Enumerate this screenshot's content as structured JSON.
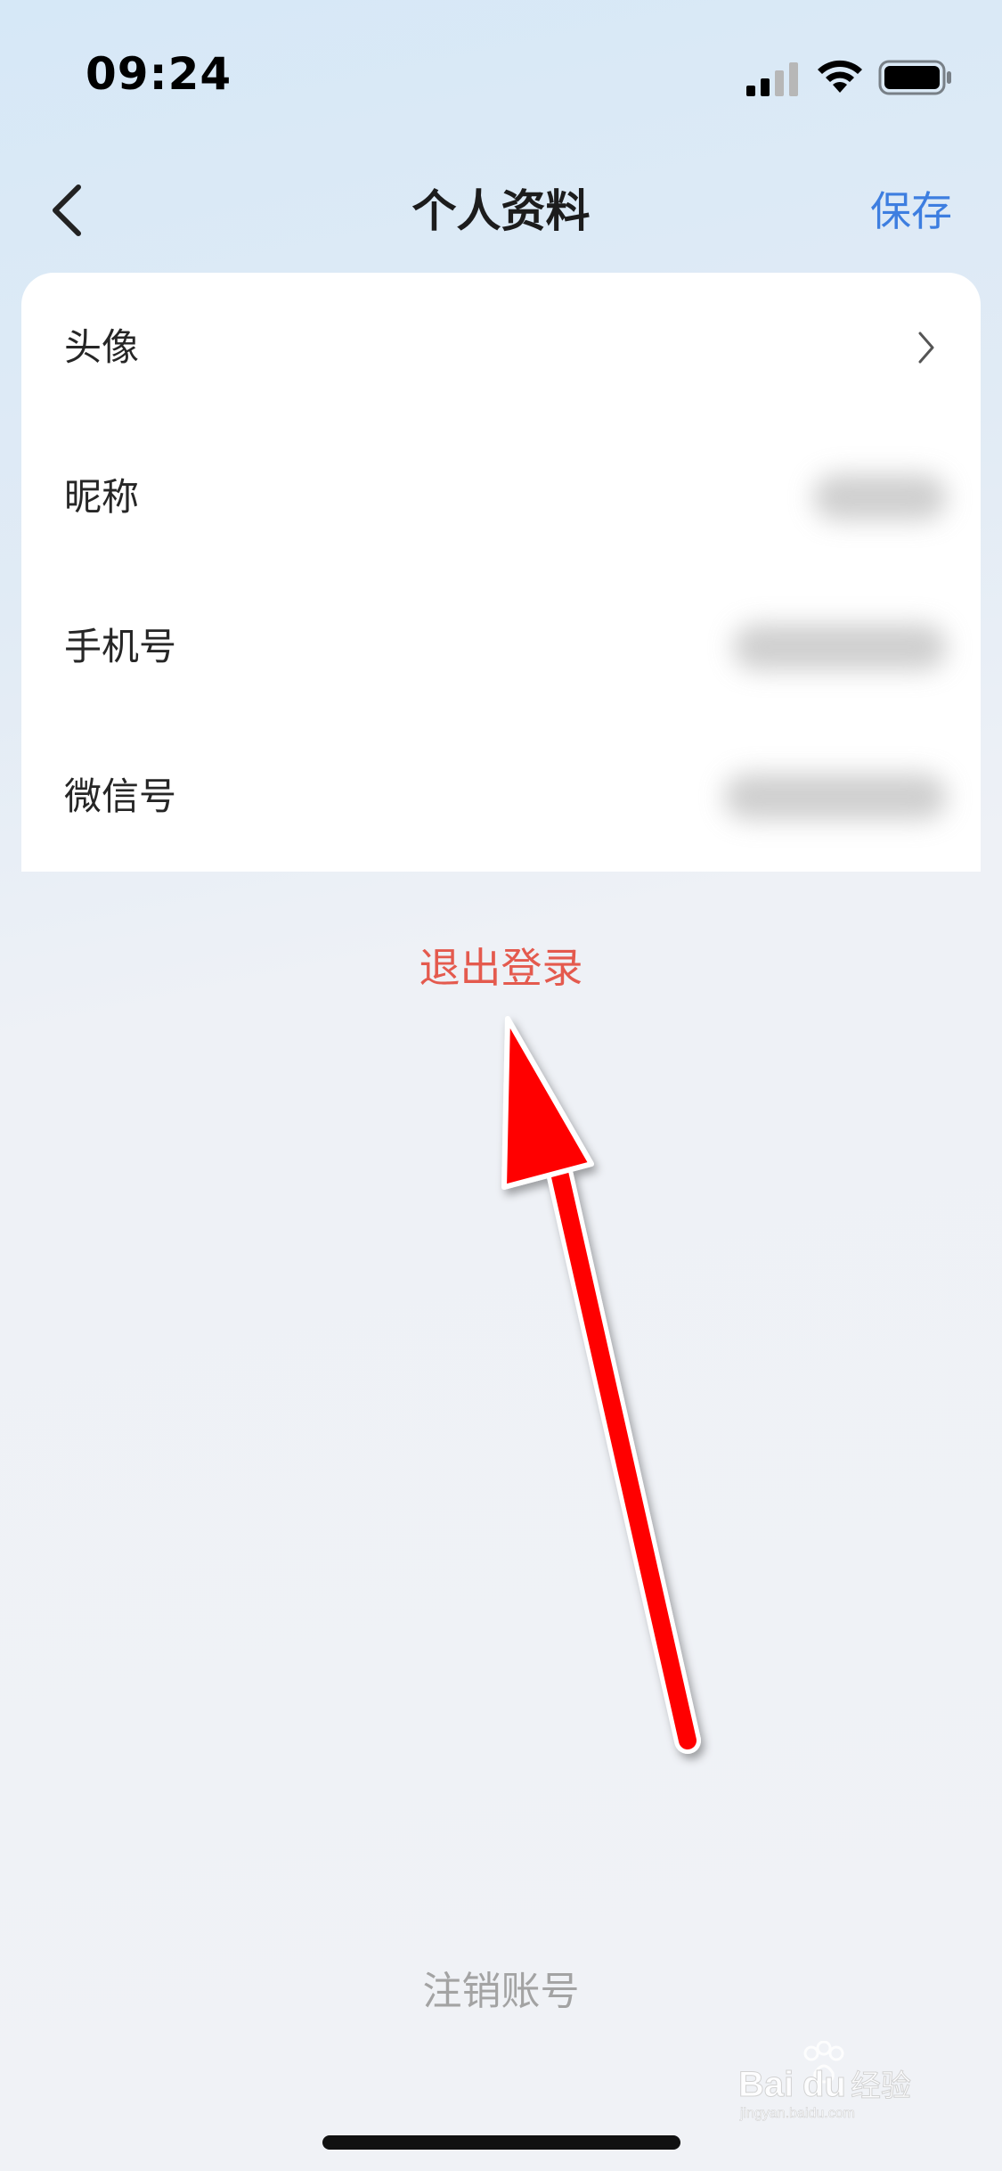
{
  "status_bar": {
    "time": "09:24",
    "icons": [
      "cellular-signal-icon",
      "wifi-icon",
      "battery-icon"
    ]
  },
  "nav": {
    "back_icon": "chevron-left-icon",
    "title": "个人资料",
    "save_label": "保存"
  },
  "profile": {
    "rows": [
      {
        "label": "头像",
        "trailing": "chevron-right-icon"
      },
      {
        "label": "昵称",
        "value_state": "blurred"
      },
      {
        "label": "手机号",
        "value_state": "blurred"
      },
      {
        "label": "微信号",
        "value_state": "blurred"
      }
    ]
  },
  "actions": {
    "logout_label": "退出登录",
    "cancel_account_label": "注销账号"
  },
  "annotation": {
    "type": "red-arrow",
    "target": "logout-button"
  },
  "watermark": {
    "text": "Baidu 经验",
    "subtext": "jingyan.baidu.com"
  },
  "colors": {
    "accent_blue": "#3d7ee0",
    "logout_red": "#e45a4e",
    "muted_gray": "#a3a3a3",
    "arrow_red": "#ff0000",
    "card_bg": "#ffffff"
  }
}
